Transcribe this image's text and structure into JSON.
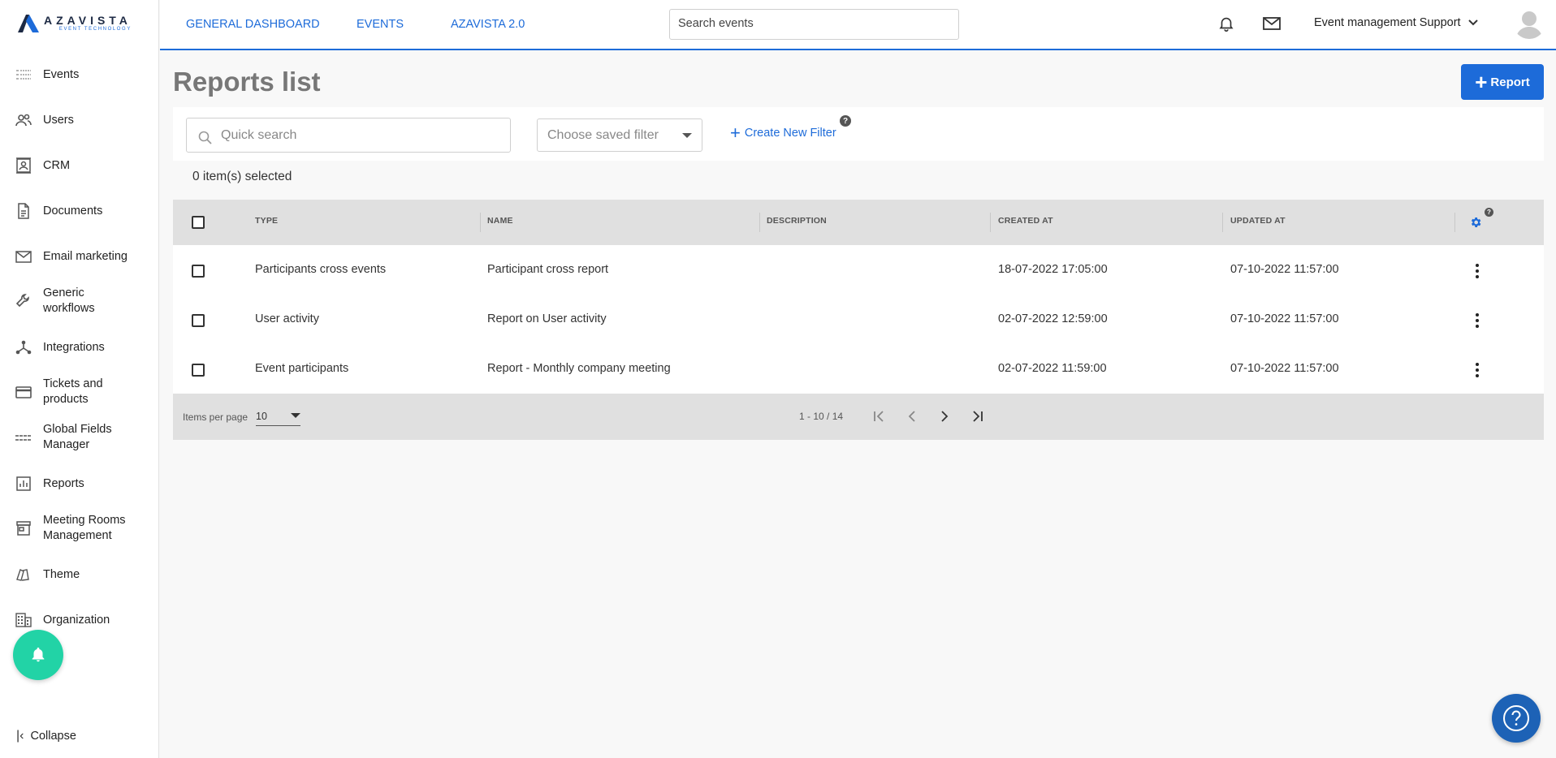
{
  "brand": {
    "name": "AZAVISTA",
    "tagline": "EVENT TECHNOLOGY",
    "accent": "#1d6bd9"
  },
  "sidebar": {
    "items": [
      {
        "label": "Events",
        "icon": "events-list-icon"
      },
      {
        "label": "Users",
        "icon": "users-icon"
      },
      {
        "label": "CRM",
        "icon": "contact-card-icon"
      },
      {
        "label": "Documents",
        "icon": "document-icon"
      },
      {
        "label": "Email marketing",
        "icon": "mail-icon"
      },
      {
        "label": "Generic workflows",
        "icon": "wrench-icon"
      },
      {
        "label": "Integrations",
        "icon": "integrations-icon"
      },
      {
        "label": "Tickets and products",
        "icon": "card-icon"
      },
      {
        "label": "Global Fields Manager",
        "icon": "fields-icon"
      },
      {
        "label": "Reports",
        "icon": "bar-chart-icon"
      },
      {
        "label": "Meeting Rooms Management",
        "icon": "store-icon"
      },
      {
        "label": "Theme",
        "icon": "theme-icon"
      },
      {
        "label": "Organization",
        "icon": "building-icon"
      }
    ],
    "collapse_label": "Collapse"
  },
  "topbar": {
    "links": [
      "GENERAL DASHBOARD",
      "EVENTS",
      "AZAVISTA 2.0"
    ],
    "search_placeholder": "Search events",
    "user_name": "Event management Support"
  },
  "page": {
    "title": "Reports list",
    "add_button": "Report",
    "quick_search_placeholder": "Quick search",
    "saved_filter_placeholder": "Choose saved filter",
    "create_filter_label": "Create New Filter",
    "help_mark": "?",
    "selected_count": "0 item(s) selected"
  },
  "table": {
    "columns": [
      "TYPE",
      "NAME",
      "DESCRIPTION",
      "CREATED AT",
      "UPDATED AT"
    ],
    "rows": [
      {
        "type": "Participants cross events",
        "name": "Participant cross report",
        "description": "",
        "created": "18-07-2022 17:05:00",
        "updated": "07-10-2022 11:57:00"
      },
      {
        "type": "User activity",
        "name": "Report on User activity",
        "description": "",
        "created": "02-07-2022 12:59:00",
        "updated": "07-10-2022 11:57:00"
      },
      {
        "type": "Event participants",
        "name": "Report - Monthly company meeting",
        "description": "",
        "created": "02-07-2022 11:59:00",
        "updated": "07-10-2022 11:57:00"
      }
    ],
    "footer": {
      "items_per_page_label": "Items per page",
      "items_per_page": "10",
      "range": "1 - 10 / 14"
    }
  }
}
